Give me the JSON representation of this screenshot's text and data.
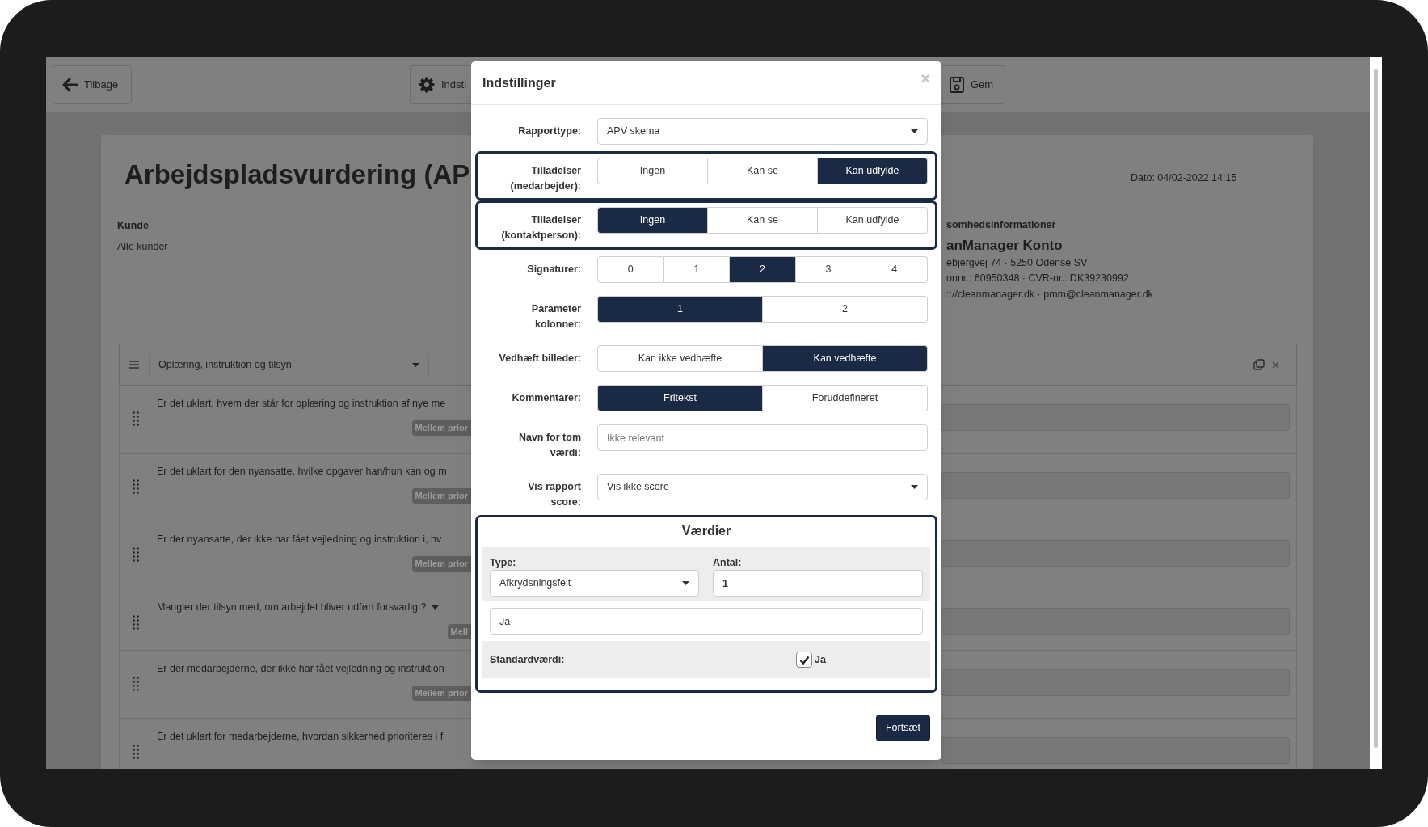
{
  "toolbar": [
    {
      "kind": "back",
      "label": "Tilbage"
    },
    {
      "kind": "settings",
      "label": "Indsti"
    },
    {
      "kind": "save",
      "label": "Gem"
    }
  ],
  "report": {
    "title": "Arbejdspladsvurdering (AP",
    "date": "Dato: 04/02-2022 14:15",
    "customer": {
      "heading": "Kunde",
      "value": "Alle kunder"
    },
    "company": {
      "heading": "somhedsinformationer",
      "name": "anManager Konto",
      "lines": [
        "ebjergvej 74 · 5250 Odense SV",
        "onnr.: 60950348 · CVR-nr.: DK39230992",
        ":://cleanmanager.dk · pmm@cleanmanager.dk"
      ]
    }
  },
  "section": {
    "category": "Oplæring, instruktion og tilsyn",
    "questions": [
      {
        "text": "Er det uklart, hvem der står for oplæring og instruktion af nye me",
        "dropdown": false,
        "priority": "Mellem prior"
      },
      {
        "text": "Er det uklart for den nyansatte, hvilke opgaver han/hun kan og m",
        "dropdown": false,
        "priority": "Mellem prior"
      },
      {
        "text": "Er der nyansatte, der ikke har fået vejledning og instruktion i, hv",
        "dropdown": false,
        "priority": "Mellem prior"
      },
      {
        "text": "Mangler der tilsyn med, om arbejdet bliver udført forsvarligt?",
        "dropdown": true,
        "priority": "Mell"
      },
      {
        "text": "Er der medarbejderne, der ikke har fået vejledning og instruktion",
        "dropdown": false,
        "priority": "Mellem prior"
      },
      {
        "text": "Er det uklart for medarbejderne, hvordan sikkerhed prioriteres i f",
        "dropdown": false
      }
    ]
  },
  "dialog": {
    "title": "Indstillinger",
    "close": "×",
    "fields": [
      {
        "kind": "select",
        "label": [
          "Rapporttype:"
        ],
        "value": "APV skema",
        "highlighted": false
      },
      {
        "kind": "segmented",
        "label": [
          "Tilladelser",
          "(medarbejder):"
        ],
        "highlighted": true,
        "options": [
          {
            "label": "Ingen",
            "selected": false
          },
          {
            "label": "Kan se",
            "selected": false
          },
          {
            "label": "Kan udfylde",
            "selected": true
          }
        ]
      },
      {
        "kind": "segmented",
        "label": [
          "Tilladelser",
          "(kontaktperson):"
        ],
        "highlighted": true,
        "options": [
          {
            "label": "Ingen",
            "selected": true
          },
          {
            "label": "Kan se",
            "selected": false
          },
          {
            "label": "Kan udfylde",
            "selected": false
          }
        ]
      },
      {
        "kind": "segmented",
        "label": [
          "Signaturer:"
        ],
        "highlighted": false,
        "options": [
          {
            "label": "0",
            "selected": false
          },
          {
            "label": "1",
            "selected": false
          },
          {
            "label": "2",
            "selected": true
          },
          {
            "label": "3",
            "selected": false
          },
          {
            "label": "4",
            "selected": false
          }
        ]
      },
      {
        "kind": "segmented",
        "label": [
          "Parameter",
          "kolonner:"
        ],
        "highlighted": false,
        "options": [
          {
            "label": "1",
            "selected": true
          },
          {
            "label": "2",
            "selected": false
          }
        ]
      },
      {
        "kind": "segmented",
        "label": [
          "Vedhæft billeder:"
        ],
        "highlighted": false,
        "options": [
          {
            "label": "Kan ikke vedhæfte",
            "selected": false
          },
          {
            "label": "Kan vedhæfte",
            "selected": true
          }
        ]
      },
      {
        "kind": "segmented",
        "label": [
          "Kommentarer:"
        ],
        "highlighted": false,
        "options": [
          {
            "label": "Fritekst",
            "selected": true
          },
          {
            "label": "Foruddefineret",
            "selected": false
          }
        ]
      },
      {
        "kind": "input",
        "label": [
          "Navn for tom",
          "værdi:"
        ],
        "placeholder": "Ikke relevant",
        "highlighted": false
      },
      {
        "kind": "select",
        "label": [
          "Vis rapport",
          "score:"
        ],
        "value": "Vis ikke score",
        "highlighted": false
      }
    ],
    "values": {
      "title": "Værdier",
      "type_label": "Type:",
      "type_value": "Afkrydsningsfelt",
      "count_label": "Antal:",
      "count_value": "1",
      "options": [
        "Ja"
      ],
      "default_label": "Standardværdi:",
      "defaults": [
        {
          "label": "Ja",
          "checked": true
        }
      ]
    },
    "submit": "Fortsæt"
  }
}
